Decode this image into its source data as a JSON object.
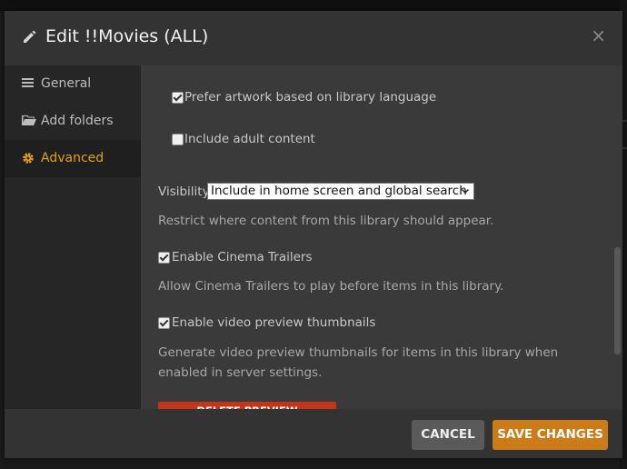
{
  "dialog": {
    "title": "Edit !!Movies (ALL)",
    "close_glyph": "×"
  },
  "sidebar": {
    "items": [
      {
        "label": "General",
        "icon": "list-icon",
        "active": false
      },
      {
        "label": "Add folders",
        "icon": "folder-icon",
        "active": false
      },
      {
        "label": "Advanced",
        "icon": "gear-icon",
        "active": true
      }
    ]
  },
  "settings": {
    "prefer_artwork": {
      "label": "Prefer artwork based on library language",
      "checked": true
    },
    "include_adult": {
      "label": "Include adult content",
      "checked": false
    },
    "visibility": {
      "label": "Visibility",
      "selected": "Include in home screen and global search",
      "help": "Restrict where content from this library should appear."
    },
    "cinema_trailers": {
      "label": "Enable Cinema Trailers",
      "checked": true,
      "help": "Allow Cinema Trailers to play before items in this library."
    },
    "video_preview": {
      "label": "Enable video preview thumbnails",
      "checked": true,
      "help": "Generate video preview thumbnails for items in this library when enabled in server settings."
    },
    "delete_preview_button": "DELETE PREVIEW THUMBNAILS"
  },
  "footer": {
    "cancel_label": "CANCEL",
    "save_label": "SAVE CHANGES"
  },
  "colors": {
    "accent": "#e5a00d",
    "save_button": "#cc7b19",
    "danger": "#c1361b"
  }
}
